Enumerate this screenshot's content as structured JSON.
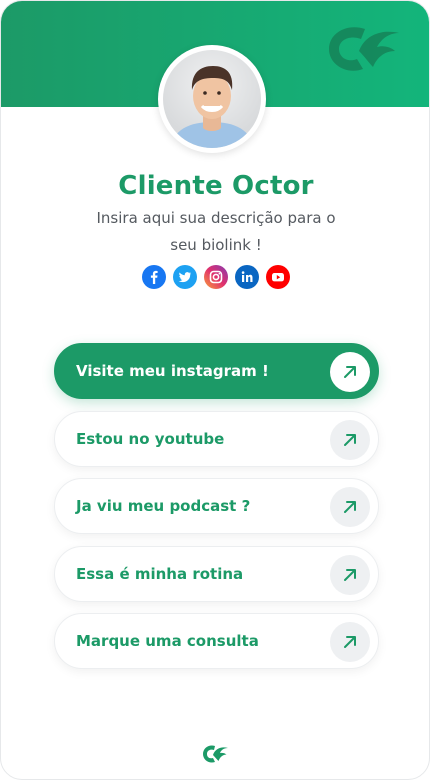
{
  "brand": {
    "color": "#1c9a67",
    "color_light": "#13b57b",
    "logo_icon": "octor-logo-icon"
  },
  "profile": {
    "name": "Cliente Octor",
    "description": "Insira aqui sua descrição para o seu biolink !",
    "avatar_icon": "avatar-photo"
  },
  "socials": [
    {
      "name": "facebook",
      "glyph": "f",
      "color": "#1877f2"
    },
    {
      "name": "twitter",
      "glyph": "t",
      "color": "#1da1f2"
    },
    {
      "name": "instagram",
      "glyph": "ig",
      "color": "#d62976"
    },
    {
      "name": "linkedin",
      "glyph": "in",
      "color": "#0a66c2"
    },
    {
      "name": "youtube",
      "glyph": "yt",
      "color": "#ff0000"
    }
  ],
  "links": [
    {
      "label": "Visite meu instagram !",
      "primary": true
    },
    {
      "label": "Estou no youtube",
      "primary": false
    },
    {
      "label": "Ja viu meu podcast ?",
      "primary": false
    },
    {
      "label": "Essa é minha rotina",
      "primary": false
    },
    {
      "label": "Marque uma consulta",
      "primary": false
    }
  ]
}
